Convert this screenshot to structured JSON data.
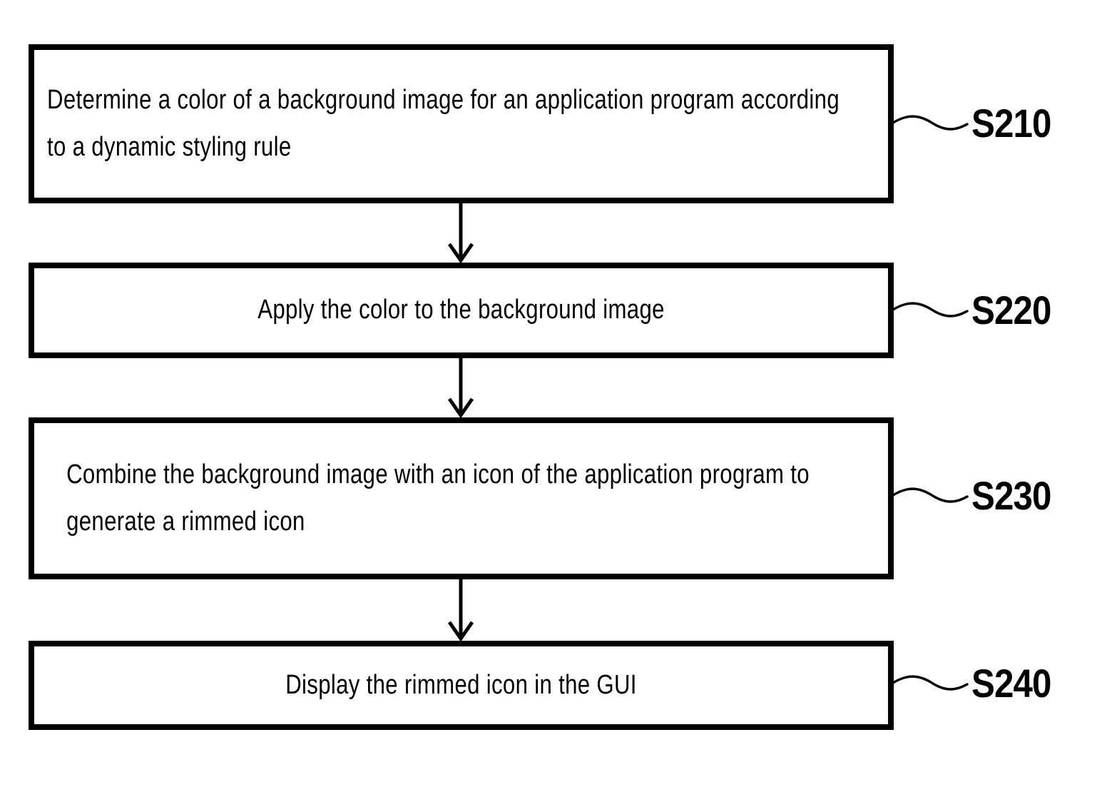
{
  "figure": {
    "type": "flowchart",
    "orientation": "vertical",
    "background_color": "#ffffff",
    "stroke_color": "#000000"
  },
  "steps": [
    {
      "id": "S210",
      "label": "S210",
      "align": "left",
      "lines": [
        "Determine a color of a background image for an application program according",
        "to a dynamic styling rule"
      ],
      "text": "Determine a color of a background image for an application program according to a dynamic styling rule"
    },
    {
      "id": "S220",
      "label": "S220",
      "align": "center",
      "lines": [
        "Apply the color to the background image"
      ],
      "text": "Apply the color to the background image"
    },
    {
      "id": "S230",
      "label": "S230",
      "align": "left",
      "lines": [
        "Combine the background image with an icon of the application program to",
        "generate a rimmed icon"
      ],
      "text": "Combine the background image with an icon of the application program to generate a rimmed icon"
    },
    {
      "id": "S240",
      "label": "S240",
      "align": "center",
      "lines": [
        "Display the rimmed icon in the GUI"
      ],
      "text": "Display the rimmed icon in the GUI"
    }
  ],
  "connectors": [
    {
      "from": "S210",
      "to": "S220",
      "kind": "arrow-down"
    },
    {
      "from": "S220",
      "to": "S230",
      "kind": "arrow-down"
    },
    {
      "from": "S230",
      "to": "S240",
      "kind": "arrow-down"
    }
  ]
}
